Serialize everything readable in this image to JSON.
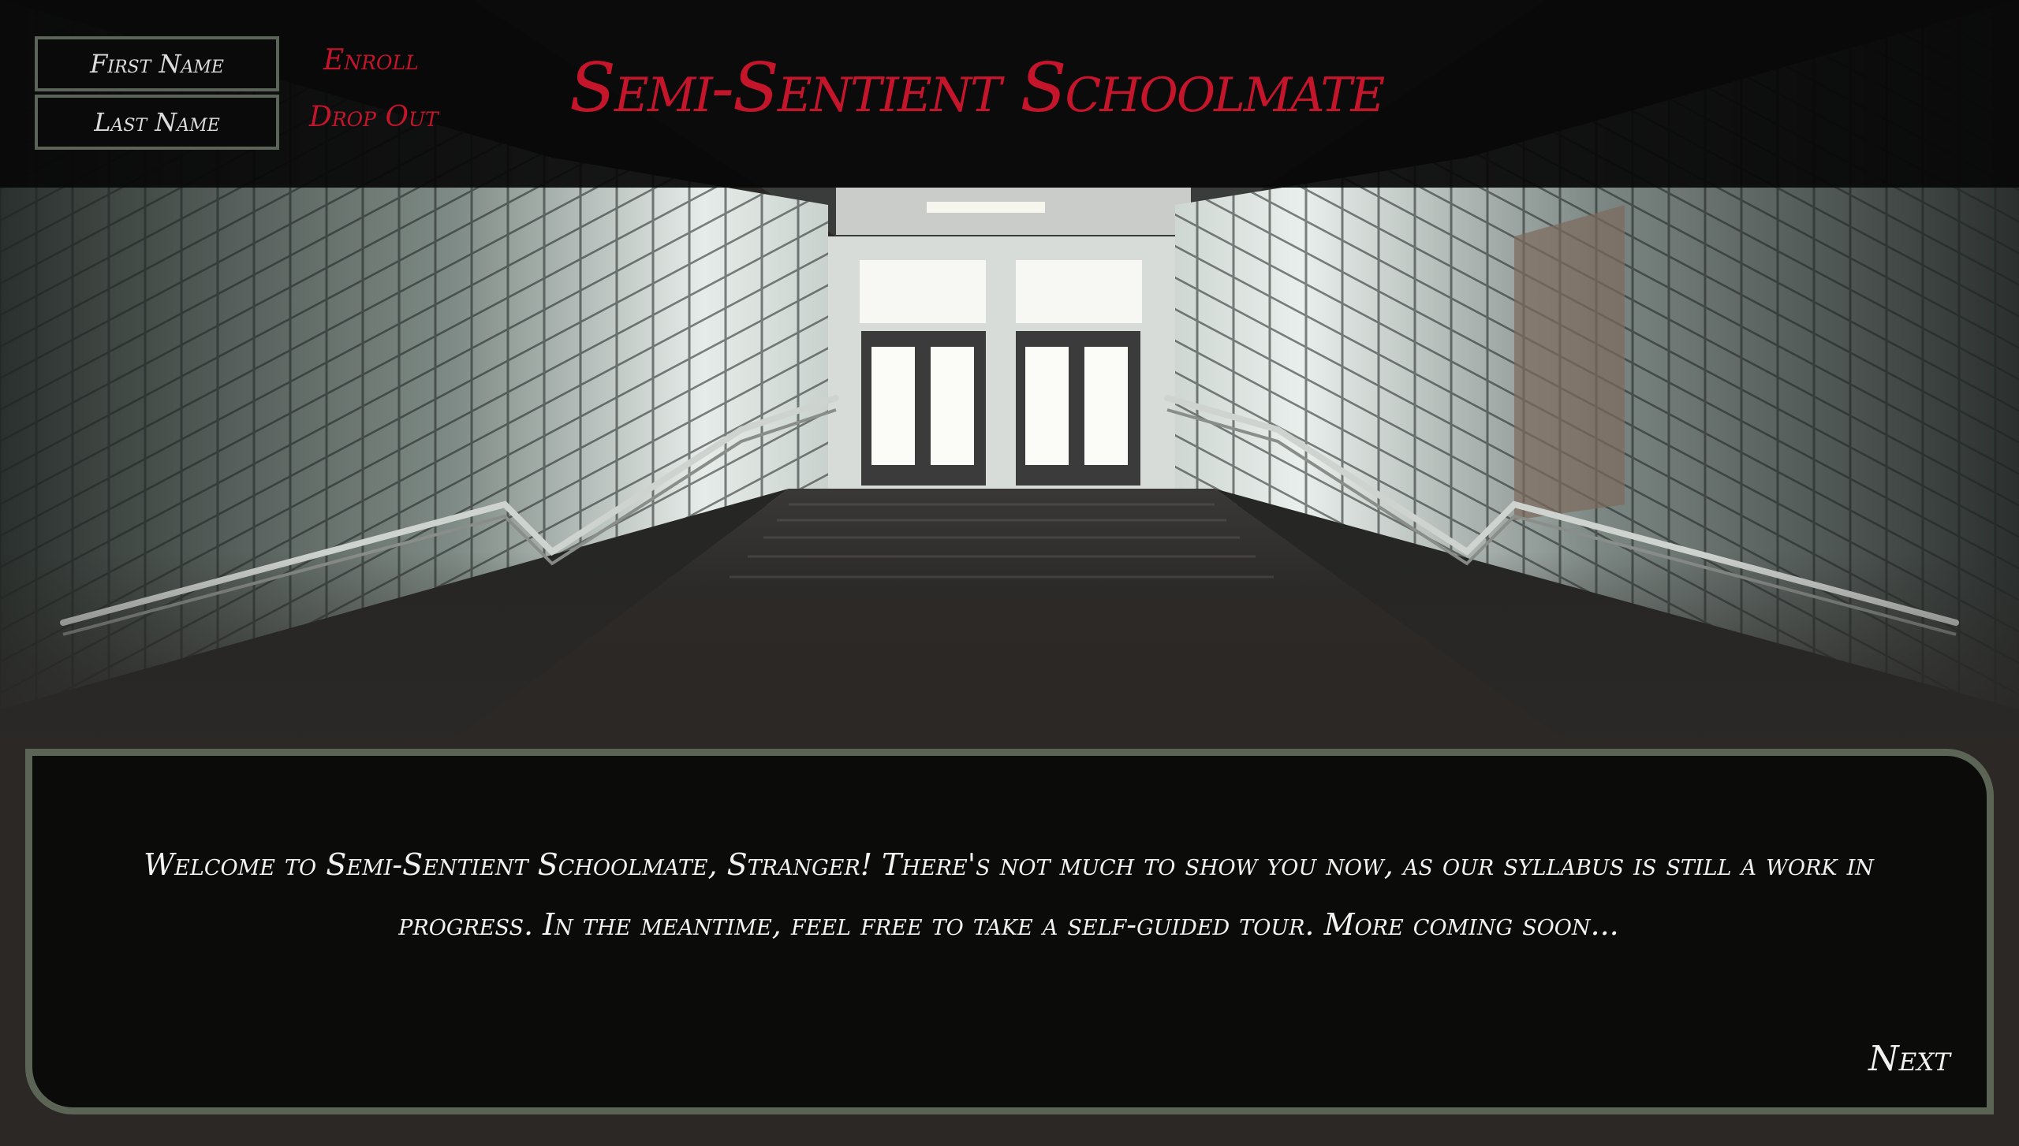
{
  "header": {
    "first_name_placeholder": "First Name",
    "last_name_placeholder": "Last Name",
    "enroll_label": "Enroll",
    "drop_out_label": "Drop Out",
    "title": "Semi-Sentient Schoolmate"
  },
  "dialog": {
    "message": "Welcome to Semi-Sentient Schoolmate, Stranger! There's not much to show you now, as our syllabus is still a work in progress. In the meantime, feel free to take a self-guided tour. More coming soon...",
    "next_label": "Next"
  },
  "colors": {
    "accent_red": "#c4152b",
    "border_green": "#5b6455",
    "panel_black": "#0b0b0a"
  }
}
